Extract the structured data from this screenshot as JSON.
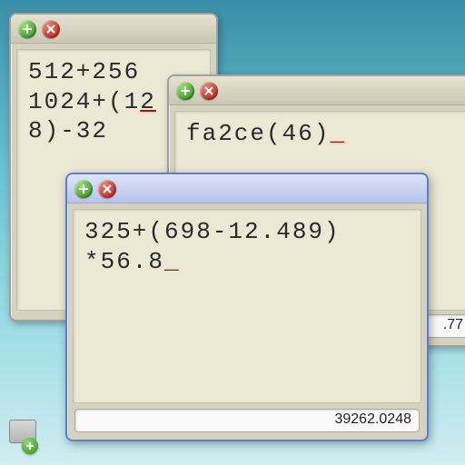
{
  "windows": {
    "back": {
      "line1_a": "512+256",
      "line1_b": "1024+(1",
      "line1_c_underlined": "2",
      "line2_a": "8)-32"
    },
    "right": {
      "text": "fa2ce(46)",
      "result_partial": ".77"
    },
    "front": {
      "line1": "325+(698-12.489)",
      "line2": "*56.8",
      "result": "39262.0248"
    }
  },
  "caret": "_"
}
